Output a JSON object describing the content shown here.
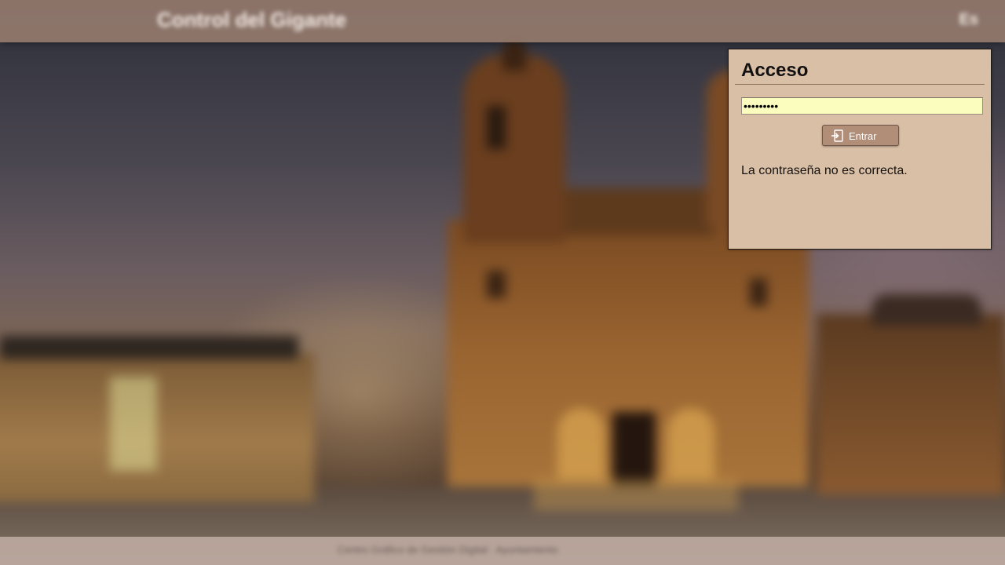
{
  "header": {
    "site_title": "Control del Gigante",
    "language": "Es"
  },
  "login": {
    "title": "Acceso",
    "password_value": "•••••••••",
    "enter_label": "Entrar",
    "enter_icon": "login-icon",
    "error_message": "La contraseña no es correcta."
  },
  "footer": {
    "text": "Centro Gráfico de Gestión Digital · Ayuntamiento"
  },
  "colors": {
    "panel_background": "#d9bfa6",
    "input_background": "#fbfdbf",
    "button_background": "#b08e78",
    "header_background": "#a08273"
  }
}
